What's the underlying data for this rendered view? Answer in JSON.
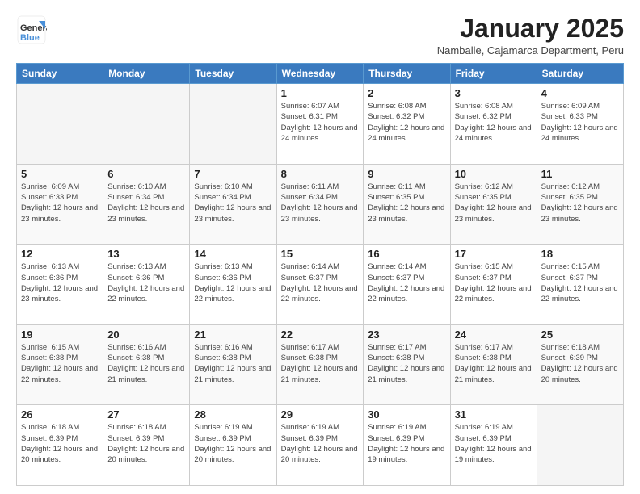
{
  "header": {
    "logo_general": "General",
    "logo_blue": "Blue",
    "month_title": "January 2025",
    "subtitle": "Namballe, Cajamarca Department, Peru"
  },
  "weekdays": [
    "Sunday",
    "Monday",
    "Tuesday",
    "Wednesday",
    "Thursday",
    "Friday",
    "Saturday"
  ],
  "weeks": [
    [
      {
        "day": "",
        "info": ""
      },
      {
        "day": "",
        "info": ""
      },
      {
        "day": "",
        "info": ""
      },
      {
        "day": "1",
        "info": "Sunrise: 6:07 AM\nSunset: 6:31 PM\nDaylight: 12 hours and 24 minutes."
      },
      {
        "day": "2",
        "info": "Sunrise: 6:08 AM\nSunset: 6:32 PM\nDaylight: 12 hours and 24 minutes."
      },
      {
        "day": "3",
        "info": "Sunrise: 6:08 AM\nSunset: 6:32 PM\nDaylight: 12 hours and 24 minutes."
      },
      {
        "day": "4",
        "info": "Sunrise: 6:09 AM\nSunset: 6:33 PM\nDaylight: 12 hours and 24 minutes."
      }
    ],
    [
      {
        "day": "5",
        "info": "Sunrise: 6:09 AM\nSunset: 6:33 PM\nDaylight: 12 hours and 23 minutes."
      },
      {
        "day": "6",
        "info": "Sunrise: 6:10 AM\nSunset: 6:34 PM\nDaylight: 12 hours and 23 minutes."
      },
      {
        "day": "7",
        "info": "Sunrise: 6:10 AM\nSunset: 6:34 PM\nDaylight: 12 hours and 23 minutes."
      },
      {
        "day": "8",
        "info": "Sunrise: 6:11 AM\nSunset: 6:34 PM\nDaylight: 12 hours and 23 minutes."
      },
      {
        "day": "9",
        "info": "Sunrise: 6:11 AM\nSunset: 6:35 PM\nDaylight: 12 hours and 23 minutes."
      },
      {
        "day": "10",
        "info": "Sunrise: 6:12 AM\nSunset: 6:35 PM\nDaylight: 12 hours and 23 minutes."
      },
      {
        "day": "11",
        "info": "Sunrise: 6:12 AM\nSunset: 6:35 PM\nDaylight: 12 hours and 23 minutes."
      }
    ],
    [
      {
        "day": "12",
        "info": "Sunrise: 6:13 AM\nSunset: 6:36 PM\nDaylight: 12 hours and 23 minutes."
      },
      {
        "day": "13",
        "info": "Sunrise: 6:13 AM\nSunset: 6:36 PM\nDaylight: 12 hours and 22 minutes."
      },
      {
        "day": "14",
        "info": "Sunrise: 6:13 AM\nSunset: 6:36 PM\nDaylight: 12 hours and 22 minutes."
      },
      {
        "day": "15",
        "info": "Sunrise: 6:14 AM\nSunset: 6:37 PM\nDaylight: 12 hours and 22 minutes."
      },
      {
        "day": "16",
        "info": "Sunrise: 6:14 AM\nSunset: 6:37 PM\nDaylight: 12 hours and 22 minutes."
      },
      {
        "day": "17",
        "info": "Sunrise: 6:15 AM\nSunset: 6:37 PM\nDaylight: 12 hours and 22 minutes."
      },
      {
        "day": "18",
        "info": "Sunrise: 6:15 AM\nSunset: 6:37 PM\nDaylight: 12 hours and 22 minutes."
      }
    ],
    [
      {
        "day": "19",
        "info": "Sunrise: 6:15 AM\nSunset: 6:38 PM\nDaylight: 12 hours and 22 minutes."
      },
      {
        "day": "20",
        "info": "Sunrise: 6:16 AM\nSunset: 6:38 PM\nDaylight: 12 hours and 21 minutes."
      },
      {
        "day": "21",
        "info": "Sunrise: 6:16 AM\nSunset: 6:38 PM\nDaylight: 12 hours and 21 minutes."
      },
      {
        "day": "22",
        "info": "Sunrise: 6:17 AM\nSunset: 6:38 PM\nDaylight: 12 hours and 21 minutes."
      },
      {
        "day": "23",
        "info": "Sunrise: 6:17 AM\nSunset: 6:38 PM\nDaylight: 12 hours and 21 minutes."
      },
      {
        "day": "24",
        "info": "Sunrise: 6:17 AM\nSunset: 6:38 PM\nDaylight: 12 hours and 21 minutes."
      },
      {
        "day": "25",
        "info": "Sunrise: 6:18 AM\nSunset: 6:39 PM\nDaylight: 12 hours and 20 minutes."
      }
    ],
    [
      {
        "day": "26",
        "info": "Sunrise: 6:18 AM\nSunset: 6:39 PM\nDaylight: 12 hours and 20 minutes."
      },
      {
        "day": "27",
        "info": "Sunrise: 6:18 AM\nSunset: 6:39 PM\nDaylight: 12 hours and 20 minutes."
      },
      {
        "day": "28",
        "info": "Sunrise: 6:19 AM\nSunset: 6:39 PM\nDaylight: 12 hours and 20 minutes."
      },
      {
        "day": "29",
        "info": "Sunrise: 6:19 AM\nSunset: 6:39 PM\nDaylight: 12 hours and 20 minutes."
      },
      {
        "day": "30",
        "info": "Sunrise: 6:19 AM\nSunset: 6:39 PM\nDaylight: 12 hours and 19 minutes."
      },
      {
        "day": "31",
        "info": "Sunrise: 6:19 AM\nSunset: 6:39 PM\nDaylight: 12 hours and 19 minutes."
      },
      {
        "day": "",
        "info": ""
      }
    ]
  ]
}
